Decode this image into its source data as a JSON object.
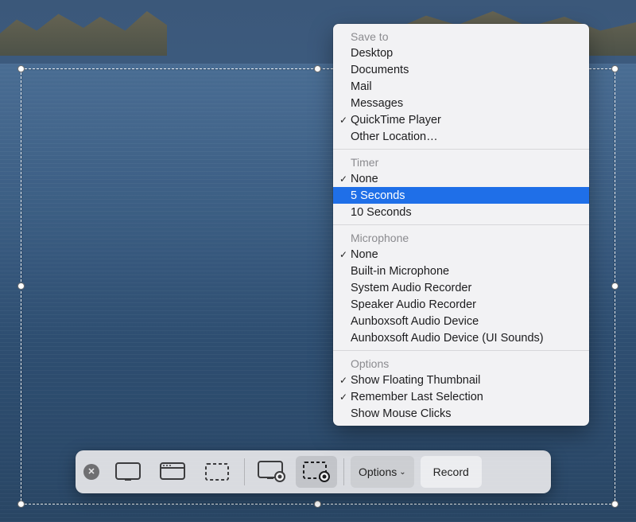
{
  "toolbar": {
    "close_title": "Close",
    "options_label": "Options",
    "record_label": "Record",
    "modes": [
      {
        "name": "capture-entire-screen",
        "title": "Capture Entire Screen"
      },
      {
        "name": "capture-window",
        "title": "Capture Selected Window"
      },
      {
        "name": "capture-selection",
        "title": "Capture Selected Portion"
      },
      {
        "name": "record-entire-screen",
        "title": "Record Entire Screen"
      },
      {
        "name": "record-selection",
        "title": "Record Selected Portion",
        "active": true
      }
    ]
  },
  "options_menu": {
    "sections": [
      {
        "title": "Save to",
        "items": [
          {
            "label": "Desktop",
            "checked": false
          },
          {
            "label": "Documents",
            "checked": false
          },
          {
            "label": "Mail",
            "checked": false
          },
          {
            "label": "Messages",
            "checked": false
          },
          {
            "label": "QuickTime Player",
            "checked": true
          },
          {
            "label": "Other Location…",
            "checked": false
          }
        ]
      },
      {
        "title": "Timer",
        "items": [
          {
            "label": "None",
            "checked": true
          },
          {
            "label": "5 Seconds",
            "checked": false,
            "highlight": true
          },
          {
            "label": "10 Seconds",
            "checked": false
          }
        ]
      },
      {
        "title": "Microphone",
        "items": [
          {
            "label": "None",
            "checked": true
          },
          {
            "label": "Built-in Microphone",
            "checked": false
          },
          {
            "label": "System Audio Recorder",
            "checked": false
          },
          {
            "label": "Speaker Audio Recorder",
            "checked": false
          },
          {
            "label": "Aunboxsoft Audio Device",
            "checked": false
          },
          {
            "label": "Aunboxsoft Audio Device (UI Sounds)",
            "checked": false
          }
        ]
      },
      {
        "title": "Options",
        "items": [
          {
            "label": "Show Floating Thumbnail",
            "checked": true
          },
          {
            "label": "Remember Last Selection",
            "checked": true
          },
          {
            "label": "Show Mouse Clicks",
            "checked": false
          }
        ]
      }
    ]
  }
}
